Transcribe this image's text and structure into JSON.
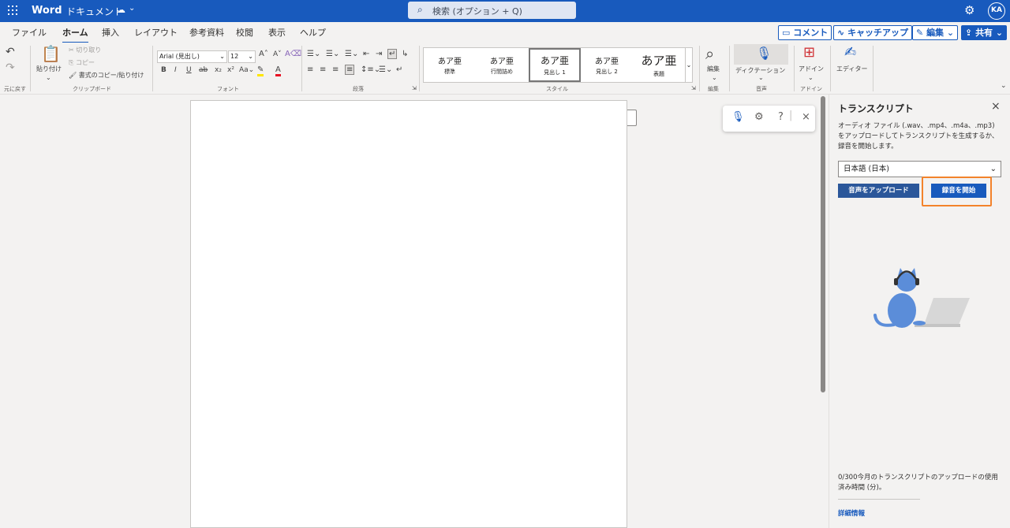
{
  "titlebar": {
    "app_name": "Word",
    "doc_name": "ドキュメント",
    "search_placeholder": "検索 (オプション + Q)",
    "avatar_initials": "KA"
  },
  "menu": {
    "tabs": [
      "ファイル",
      "ホーム",
      "挿入",
      "レイアウト",
      "参考資料",
      "校閲",
      "表示",
      "ヘルプ"
    ],
    "active_tab": "ホーム",
    "comment_label": "コメント",
    "catchup_label": "キャッチアップ",
    "edit_label": "編集",
    "share_label": "共有"
  },
  "ribbon": {
    "undo_group": "元に戻す",
    "paste_label": "貼り付け",
    "cut_label": "切り取り",
    "copy_label": "コピー",
    "format_painter_label": "書式のコピー/貼り付け",
    "clipboard_group": "クリップボード",
    "font_name": "Arial (見出し)",
    "font_size": "12",
    "font_group": "フォント",
    "paragraph_group": "段落",
    "styles_group": "スタイル",
    "styles": [
      {
        "preview": "あア亜",
        "name": "標準"
      },
      {
        "preview": "あア亜",
        "name": "行間詰め"
      },
      {
        "preview": "あア亜",
        "name": "見出し 1"
      },
      {
        "preview": "あア亜",
        "name": "見出し 2"
      },
      {
        "preview": "あア亜",
        "name": "表題"
      }
    ],
    "edit_label": "編集",
    "edit_group": "編集",
    "dictation_label": "ディクテーション",
    "voice_group": "音声",
    "addins_label": "アドイン",
    "addins_group": "アドイン",
    "editor_label": "エディター"
  },
  "pane": {
    "title": "トランスクリプト",
    "description": "オーディオ ファイル (.wav、.mp4、.m4a、.mp3) をアップロードしてトランスクリプトを生成するか、録音を開始します。",
    "language": "日本語 (日本)",
    "upload_button": "音声をアップロード",
    "record_button": "録音を開始",
    "usage_text": "0/300今月のトランスクリプトのアップロードの使用済み時間 (分)。",
    "details_link": "詳細情報"
  },
  "colors": {
    "brand": "#185abd",
    "highlight": "#f3832b"
  }
}
